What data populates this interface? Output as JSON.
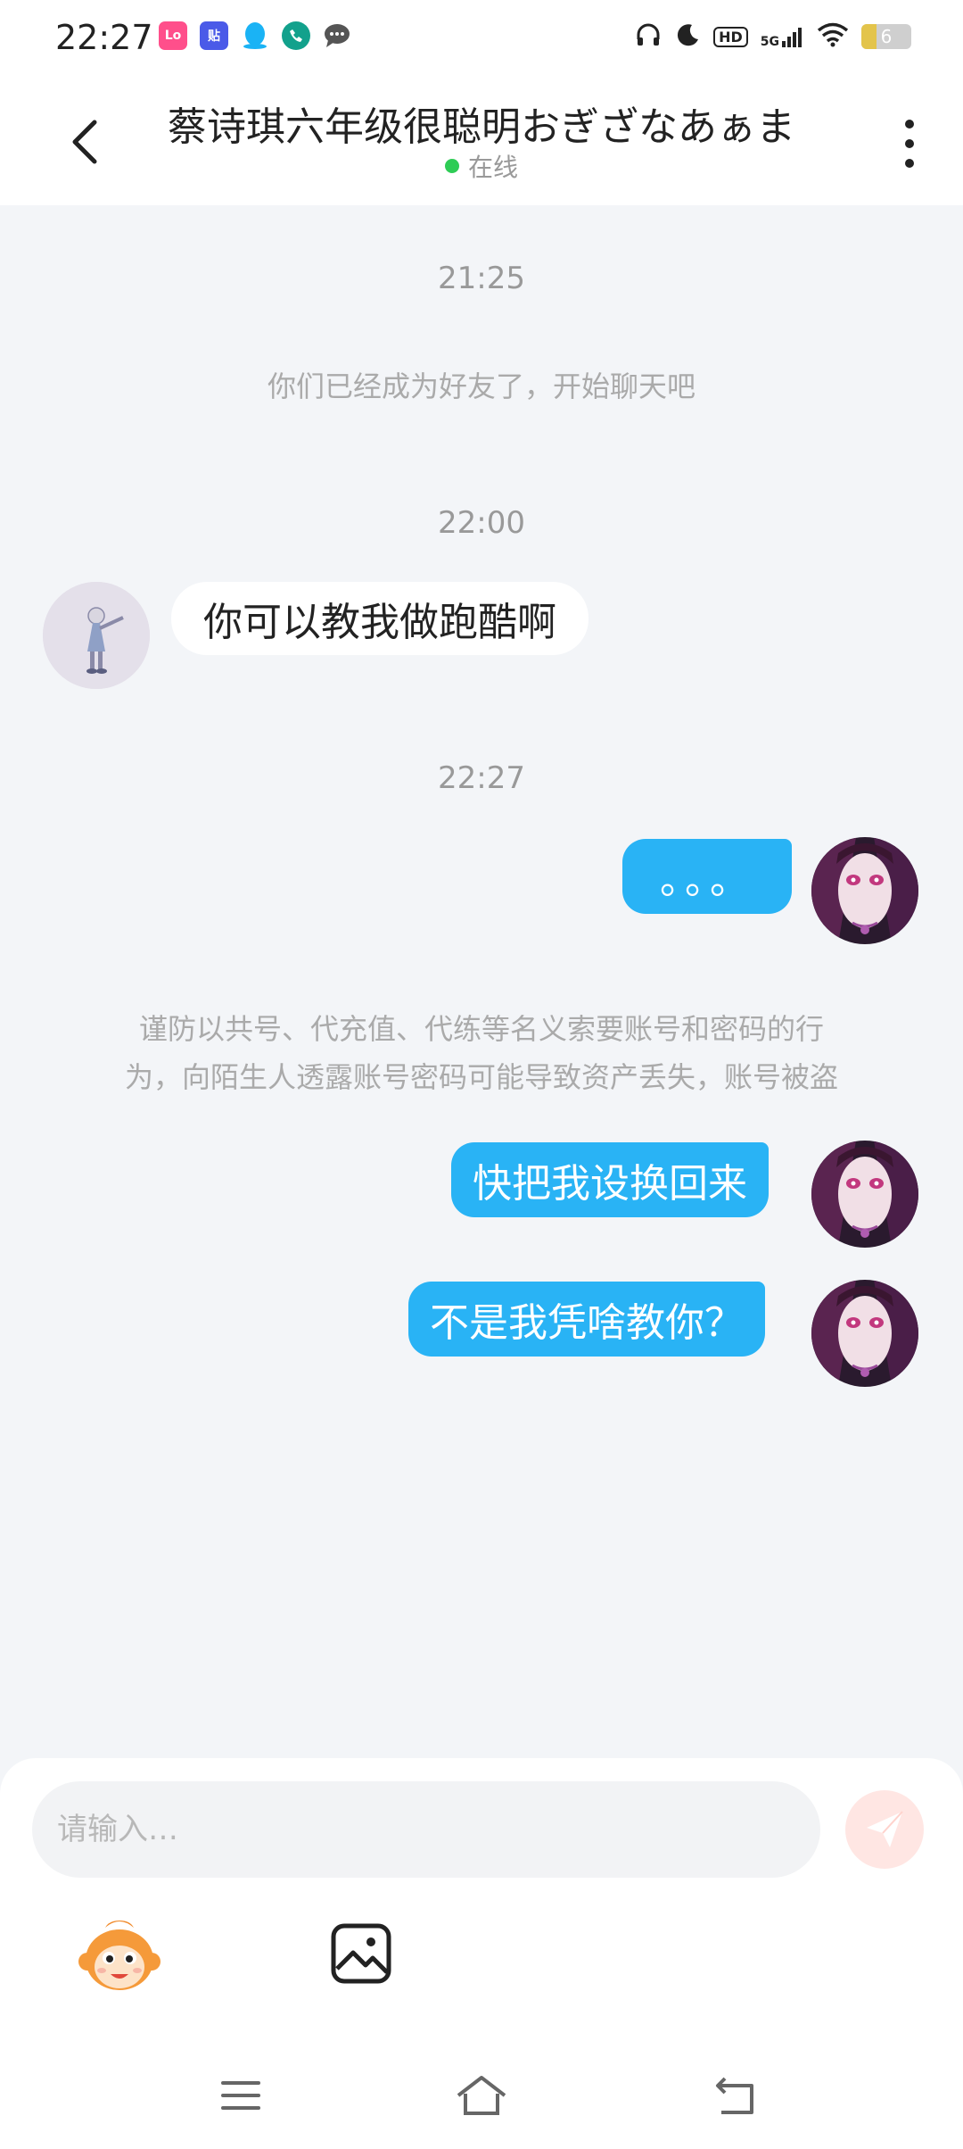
{
  "status_bar": {
    "time": "22:27",
    "app_icons": [
      {
        "name": "lofter-app-icon",
        "label": "Lo",
        "color": "#ff4f8b"
      },
      {
        "name": "tieba-app-icon",
        "label": "贴",
        "color": "#4a5ae8"
      },
      {
        "name": "qq-app-icon",
        "label": "",
        "color": "#1ab3f5"
      },
      {
        "name": "phone-app-icon",
        "label": "",
        "color": "#12a18c"
      },
      {
        "name": "message-app-icon",
        "label": "",
        "color": "#555555"
      }
    ],
    "hd_label": "HD",
    "network_label": "5G",
    "battery_level": "6"
  },
  "header": {
    "title": "蔡诗琪六年级很聪明おぎざなあぁま",
    "status": "在线",
    "status_color": "#2ecc55"
  },
  "messages": {
    "time_1": "21:25",
    "system_friend": "你们已经成为好友了，开始聊天吧",
    "time_2": "22:00",
    "incoming_1": "你可以教我做跑酷啊",
    "time_3": "22:27",
    "outgoing_1": "。。。",
    "system_warning_line1": "谨防以共号、代充值、代练等名义索要账号和密码的行",
    "system_warning_line2": "为，向陌生人透露账号密码可能导致资产丢失，账号被盗",
    "outgoing_2": "快把我设换回来",
    "outgoing_3": "不是我凭啥教你？",
    "outgoing_bubble_color": "#29b3f5"
  },
  "composer": {
    "placeholder": "请输入…",
    "send_button_color": "#ff8f80"
  }
}
